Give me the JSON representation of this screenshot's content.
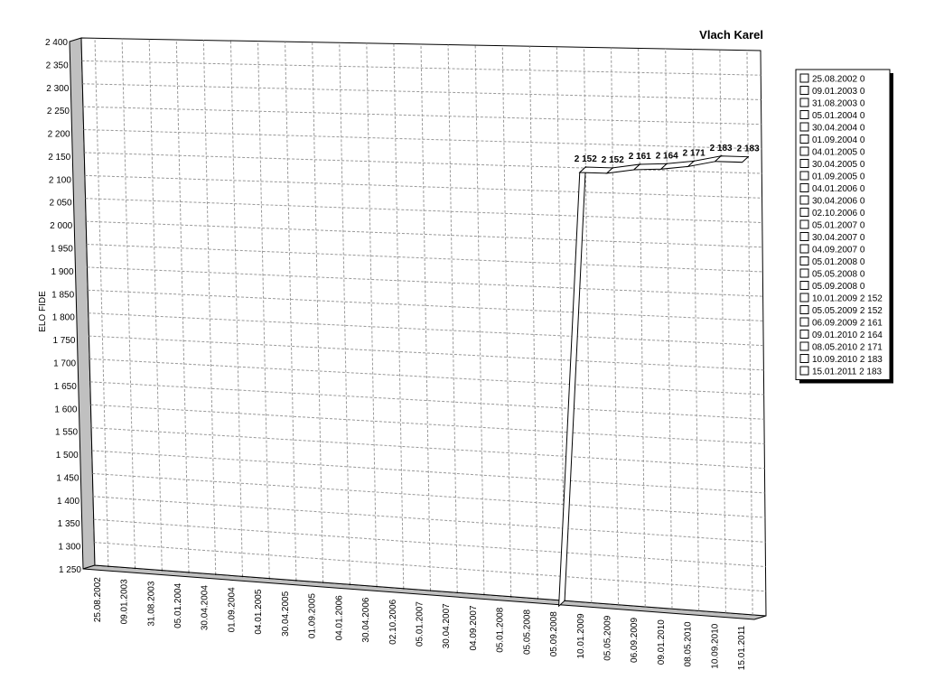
{
  "chart_data": {
    "type": "line",
    "title": "Vlach Karel",
    "xlabel": "",
    "ylabel": "ELO FIDE",
    "ylim": [
      1250,
      2400
    ],
    "yticks": [
      "1 250",
      "1 300",
      "1 350",
      "1 400",
      "1 450",
      "1 500",
      "1 550",
      "1 600",
      "1 650",
      "1 700",
      "1 750",
      "1 800",
      "1 850",
      "1 900",
      "1 950",
      "2 000",
      "2 050",
      "2 100",
      "2 150",
      "2 200",
      "2 250",
      "2 300",
      "2 350",
      "2 400"
    ],
    "categories": [
      "25.08.2002",
      "09.01.2003",
      "31.08.2003",
      "05.01.2004",
      "30.04.2004",
      "01.09.2004",
      "04.01.2005",
      "30.04.2005",
      "01.09.2005",
      "04.01.2006",
      "30.04.2006",
      "02.10.2006",
      "05.01.2007",
      "30.04.2007",
      "04.09.2007",
      "05.01.2008",
      "05.05.2008",
      "05.09.2008",
      "10.01.2009",
      "05.05.2009",
      "06.09.2009",
      "09.01.2010",
      "08.05.2010",
      "10.09.2010",
      "15.01.2011"
    ],
    "values": [
      0,
      0,
      0,
      0,
      0,
      0,
      0,
      0,
      0,
      0,
      0,
      0,
      0,
      0,
      0,
      0,
      0,
      0,
      2152,
      2152,
      2161,
      2164,
      2171,
      2183,
      2183
    ],
    "data_labels": [
      "",
      "",
      "",
      "",
      "",
      "",
      "",
      "",
      "",
      "",
      "",
      "",
      "",
      "",
      "",
      "",
      "",
      "",
      "2 152",
      "2 152",
      "2 161",
      "2 164",
      "2 171",
      "2 183",
      "2 183"
    ],
    "legend_position": "right",
    "legend": [
      "25.08.2002 0",
      "09.01.2003 0",
      "31.08.2003 0",
      "05.01.2004 0",
      "30.04.2004 0",
      "01.09.2004 0",
      "04.01.2005 0",
      "30.04.2005 0",
      "01.09.2005 0",
      "04.01.2006 0",
      "30.04.2006 0",
      "02.10.2006 0",
      "05.01.2007 0",
      "30.04.2007 0",
      "04.09.2007 0",
      "05.01.2008 0",
      "05.05.2008 0",
      "05.09.2008 0",
      "10.01.2009 2 152",
      "05.05.2009 2 152",
      "06.09.2009 2 161",
      "09.01.2010 2 164",
      "08.05.2010 2 171",
      "10.09.2010 2 183",
      "15.01.2011 2 183"
    ],
    "grid": true,
    "style": "3d",
    "colors": {
      "background": "#ffffff",
      "grid": "#999999",
      "wall_side": "#c0c0c0",
      "line_fill": "#ffffff",
      "line_stroke": "#000000"
    }
  }
}
